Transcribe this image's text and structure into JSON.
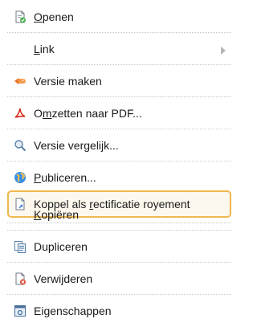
{
  "menu": {
    "items": [
      {
        "pre": "",
        "key": "O",
        "post": "penen",
        "icon": "open-document-icon"
      },
      {
        "pre": "",
        "key": "L",
        "post": "ink",
        "icon": "",
        "submenu": "chevron-right-icon"
      },
      {
        "pre": "",
        "key": "",
        "post": "Versie maken",
        "icon": "new-version-icon"
      },
      {
        "pre": "O",
        "key": "m",
        "post": "zetten naar PDF...",
        "icon": "pdf-icon"
      },
      {
        "pre": "",
        "key": "",
        "post": "Versie vergelijk...",
        "icon": "magnifier-compare-icon"
      },
      {
        "pre": "",
        "key": "P",
        "post": "ubliceren...",
        "icon": "globe-publish-icon"
      },
      {
        "pre": "Koppel als ",
        "key": "r",
        "post": "ectificatie royement",
        "icon": "link-document-icon",
        "selected": true
      },
      {
        "pre": "",
        "key": "K",
        "post": "opiëren",
        "icon": ""
      },
      {
        "pre": "",
        "key": "",
        "post": "Dupliceren",
        "icon": "duplicate-icon"
      },
      {
        "pre": "",
        "key": "",
        "post": "Verwijderen",
        "icon": "delete-document-icon"
      },
      {
        "pre": "",
        "key": "",
        "post": "Eigenschappen",
        "icon": "properties-icon"
      }
    ]
  },
  "colors": {
    "selection_border": "#f0b84e",
    "text": "#1a1a1a",
    "separator": "#c9c9c9"
  }
}
